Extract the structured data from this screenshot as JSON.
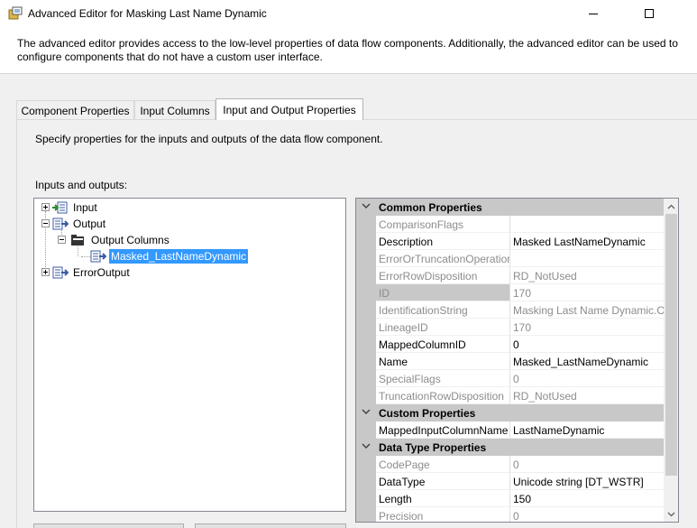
{
  "window": {
    "title": "Advanced Editor for Masking Last Name Dynamic"
  },
  "header": {
    "description": "The advanced editor provides access to the low-level properties of data flow components. Additionally, the advanced editor can be used to configure components that do not have a custom user interface."
  },
  "tabs": [
    {
      "label": "Component Properties",
      "active": false
    },
    {
      "label": "Input Columns",
      "active": false
    },
    {
      "label": "Input and Output Properties",
      "active": true
    }
  ],
  "panel": {
    "description": "Specify properties for the inputs and outputs of the data flow component.",
    "io_label": "Inputs and outputs:"
  },
  "tree": {
    "input": "Input",
    "output": "Output",
    "output_columns": "Output Columns",
    "selected_column": "Masked_LastNameDynamic",
    "error_output": "ErrorOutput"
  },
  "properties": {
    "categories": {
      "common": "Common Properties",
      "custom": "Custom Properties",
      "data_type": "Data Type Properties"
    },
    "common": [
      {
        "name": "ComparisonFlags",
        "value": ""
      },
      {
        "name": "Description",
        "value": "Masked LastNameDynamic"
      },
      {
        "name": "ErrorOrTruncationOperation",
        "value": ""
      },
      {
        "name": "ErrorRowDisposition",
        "value": "RD_NotUsed"
      },
      {
        "name": "ID",
        "value": "170"
      },
      {
        "name": "IdentificationString",
        "value": "Masking Last Name Dynamic.O"
      },
      {
        "name": "LineageID",
        "value": "170"
      },
      {
        "name": "MappedColumnID",
        "value": "0"
      },
      {
        "name": "Name",
        "value": "Masked_LastNameDynamic"
      },
      {
        "name": "SpecialFlags",
        "value": "0"
      },
      {
        "name": "TruncationRowDisposition",
        "value": "RD_NotUsed"
      }
    ],
    "custom": [
      {
        "name": "MappedInputColumnName",
        "value": "LastNameDynamic"
      }
    ],
    "data_type": [
      {
        "name": "CodePage",
        "value": "0"
      },
      {
        "name": "DataType",
        "value": "Unicode string [DT_WSTR]"
      },
      {
        "name": "Length",
        "value": "150"
      },
      {
        "name": "Precision",
        "value": "0"
      }
    ]
  }
}
